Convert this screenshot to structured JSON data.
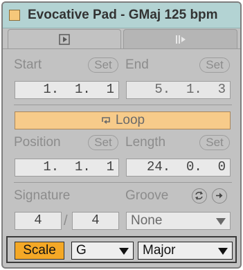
{
  "clip": {
    "title": "Evocative Pad - GMaj 125 bpm",
    "swatch_color": "#f5c77a"
  },
  "tabs": [
    {
      "icon": "play-icon",
      "active": true
    },
    {
      "icon": "audio-fader-icon",
      "active": false
    }
  ],
  "start": {
    "label": "Start",
    "set_label": "Set",
    "value": " 1.  1.  1"
  },
  "end": {
    "label": "End",
    "set_label": "Set",
    "value": " 5.  1.  3"
  },
  "loop": {
    "label": "Loop",
    "icon": "loop-icon",
    "enabled": true,
    "color": "#f7cb8a"
  },
  "position": {
    "label": "Position",
    "set_label": "Set",
    "value": " 1.  1.  1"
  },
  "length": {
    "label": "Length",
    "set_label": "Set",
    "value": "24.  0.  0"
  },
  "signature": {
    "label": "Signature",
    "numerator": "4",
    "separator": "/",
    "denominator": "4"
  },
  "groove": {
    "label": "Groove",
    "value": "None",
    "icons": [
      "groove-hot-swap-icon",
      "groove-commit-icon"
    ]
  },
  "scale": {
    "button_label": "Scale",
    "button_color": "#f4a826",
    "root": "G",
    "mode": "Major"
  }
}
